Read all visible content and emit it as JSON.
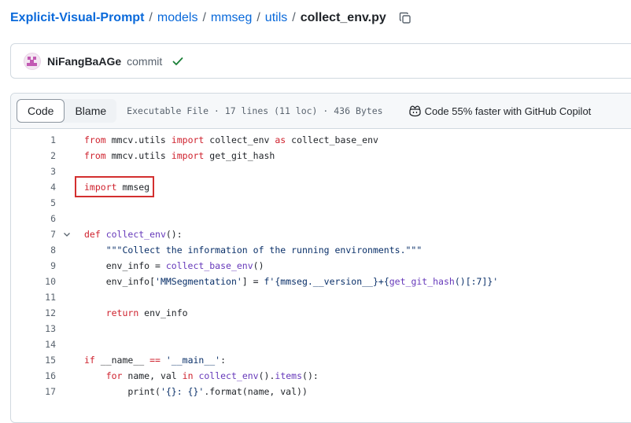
{
  "breadcrumb": {
    "repo": "Explicit-Visual-Prompt",
    "path": [
      "models",
      "mmseg",
      "utils"
    ],
    "file": "collect_env.py",
    "separator": "/"
  },
  "commit": {
    "author": "NiFangBaAGe",
    "message": "commit",
    "status_icon": "check-icon",
    "status_color": "#1a7f37"
  },
  "file_header": {
    "tabs": [
      {
        "label": "Code",
        "active": true
      },
      {
        "label": "Blame",
        "active": false
      }
    ],
    "meta": "Executable File · 17 lines (11 loc) · 436 Bytes",
    "copilot": "Code 55% faster with GitHub Copilot"
  },
  "code": {
    "highlighted_line": 4,
    "lines": [
      {
        "n": "1",
        "tokens": [
          [
            "kw",
            "from"
          ],
          [
            "",
            "mmcv.utils"
          ],
          [
            "kw",
            "import"
          ],
          [
            "",
            "collect_env"
          ],
          [
            "kw",
            "as"
          ],
          [
            "",
            "collect_base_env"
          ]
        ]
      },
      {
        "n": "2",
        "tokens": [
          [
            "kw",
            "from"
          ],
          [
            "",
            "mmcv.utils"
          ],
          [
            "kw",
            "import"
          ],
          [
            "",
            "get_git_hash"
          ]
        ]
      },
      {
        "n": "3",
        "tokens": []
      },
      {
        "n": "4",
        "tokens": [
          [
            "kw",
            "import"
          ],
          [
            "",
            "mmseg"
          ]
        ]
      },
      {
        "n": "5",
        "tokens": []
      },
      {
        "n": "6",
        "tokens": []
      },
      {
        "n": "7",
        "fold": true,
        "tokens": [
          [
            "kw",
            "def"
          ],
          [
            "fn",
            "collect_env"
          ],
          [
            "",
            "():"
          ]
        ]
      },
      {
        "n": "8",
        "tokens": [
          [
            "",
            "    "
          ],
          [
            "str",
            "\"\"\"Collect the information of the running environments.\"\"\""
          ]
        ]
      },
      {
        "n": "9",
        "tokens": [
          [
            "",
            "    env_info = "
          ],
          [
            "fn",
            "collect_base_env"
          ],
          [
            "",
            "()"
          ]
        ]
      },
      {
        "n": "10",
        "tokens": [
          [
            "",
            "    env_info["
          ],
          [
            "str",
            "'MMSegmentation'"
          ],
          [
            "",
            "] = "
          ],
          [
            "str",
            "f'{mmseg.__version__}+{"
          ],
          [
            "fn",
            "get_git_hash"
          ],
          [
            "str",
            "()[:7]}'"
          ]
        ]
      },
      {
        "n": "11",
        "tokens": []
      },
      {
        "n": "12",
        "tokens": [
          [
            "",
            "    "
          ],
          [
            "kw",
            "return"
          ],
          [
            "",
            "env_info"
          ]
        ]
      },
      {
        "n": "13",
        "tokens": []
      },
      {
        "n": "14",
        "tokens": []
      },
      {
        "n": "15",
        "tokens": [
          [
            "kw",
            "if"
          ],
          [
            "",
            "__name__"
          ],
          [
            "kw",
            "=="
          ],
          [
            "str",
            "'__main__'"
          ],
          [
            "",
            ":"
          ]
        ]
      },
      {
        "n": "16",
        "tokens": [
          [
            "",
            "    "
          ],
          [
            "kw",
            "for"
          ],
          [
            "",
            "name, val"
          ],
          [
            "kw",
            "in"
          ],
          [
            "fn",
            "collect_env"
          ],
          [
            "",
            "()."
          ],
          [
            "fn",
            "items"
          ],
          [
            "",
            "():"
          ]
        ]
      },
      {
        "n": "17",
        "tokens": [
          [
            "",
            "        print("
          ],
          [
            "str",
            "'{}: {}'"
          ],
          [
            "",
            ".format(name, val))"
          ]
        ]
      }
    ]
  }
}
